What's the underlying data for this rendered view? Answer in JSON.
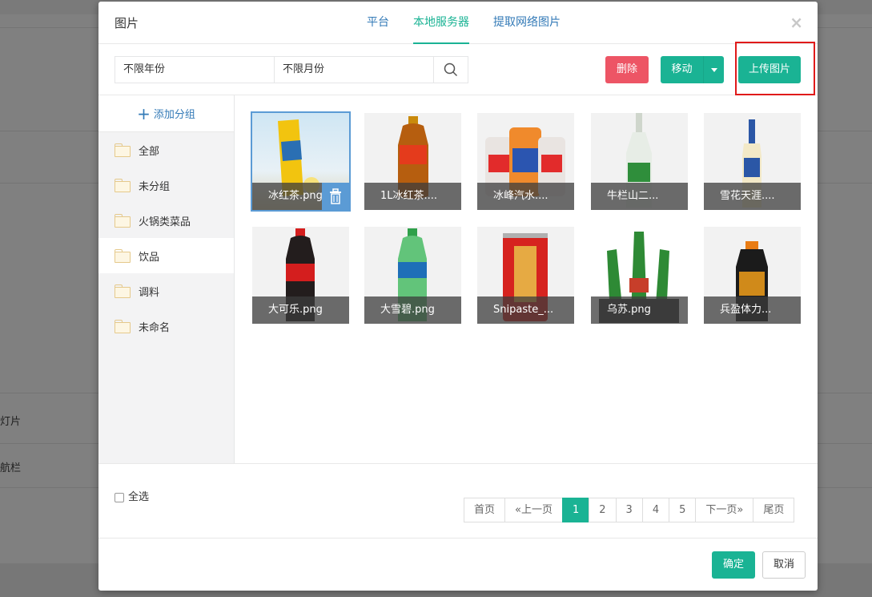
{
  "background": {
    "labels": [
      "灯片",
      "航栏"
    ]
  },
  "modal": {
    "title": "图片",
    "tabs": [
      {
        "label": "平台",
        "active": false
      },
      {
        "label": "本地服务器",
        "active": true
      },
      {
        "label": "提取网络图片",
        "active": false
      }
    ],
    "close": "×"
  },
  "toolbar": {
    "year_select": "不限年份",
    "month_select": "不限月份",
    "delete_label": "删除",
    "move_label": "移动",
    "upload_label": "上传图片"
  },
  "sidebar": {
    "add_group_label": "添加分组",
    "groups": [
      {
        "label": "全部"
      },
      {
        "label": "未分组"
      },
      {
        "label": "火锅类菜品"
      },
      {
        "label": "饮品",
        "active": true
      },
      {
        "label": "调料"
      },
      {
        "label": "未命名"
      }
    ]
  },
  "images": [
    {
      "name": "冰红茶.png",
      "selected": true
    },
    {
      "name": "1L冰红茶...."
    },
    {
      "name": "冰峰汽水...."
    },
    {
      "name": "牛栏山二..."
    },
    {
      "name": "雪花天涯...."
    },
    {
      "name": "大可乐.png"
    },
    {
      "name": "大雪碧.png"
    },
    {
      "name": "Snipaste_..."
    },
    {
      "name": "乌苏.png"
    },
    {
      "name": "兵盈体力..."
    }
  ],
  "footer": {
    "select_all_label": "全选",
    "pagination": {
      "first": "首页",
      "prev": "«上一页",
      "pages": [
        "1",
        "2",
        "3",
        "4",
        "5"
      ],
      "current": "1",
      "next": "下一页»",
      "last": "尾页"
    },
    "ok_label": "确定",
    "cancel_label": "取消"
  },
  "colors": {
    "primary": "#1ab394",
    "danger": "#ed5565",
    "link": "#337ab7",
    "highlight": "#e01a1a"
  }
}
